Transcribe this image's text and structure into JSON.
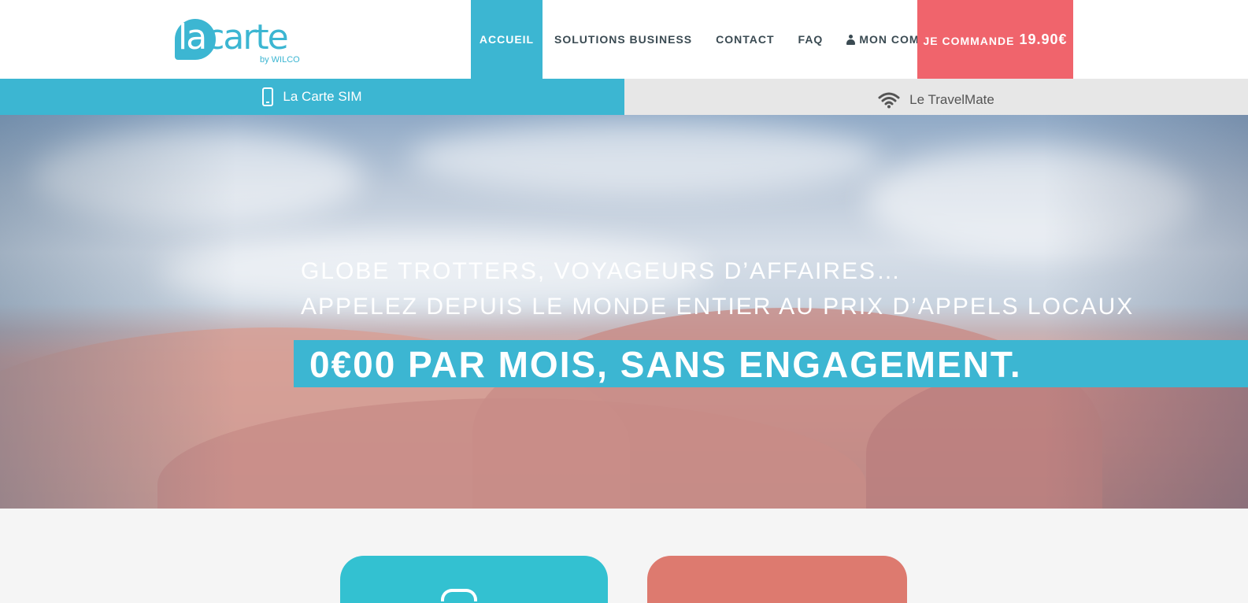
{
  "header": {
    "logo": {
      "text_la": "la",
      "text_carte": "carte",
      "byline": "by WILCO"
    },
    "nav": [
      {
        "label": "Accueil",
        "active": true
      },
      {
        "label": "Solutions Business"
      },
      {
        "label": "Contact"
      },
      {
        "label": "FAQ"
      },
      {
        "label": "Mon compte",
        "icon": "user-icon"
      }
    ],
    "cta": {
      "label": "Je commande",
      "price": "19.90€"
    }
  },
  "subnav": {
    "left": {
      "label": "La Carte SIM",
      "icon": "mobile-phone-icon"
    },
    "right": {
      "label": "Le TravelMate",
      "icon": "wifi-icon"
    }
  },
  "hero": {
    "line1": "Globe trotters, voyageurs d’affaires…",
    "line2": "Appelez depuis le monde entier au prix d’appels locaux",
    "band": "0€00 par mois, sans engagement."
  },
  "colors": {
    "accent": "#3cb6d2",
    "cta": "#f0646c",
    "card_teal": "#33c1d1",
    "card_coral": "#dd7a6f"
  }
}
